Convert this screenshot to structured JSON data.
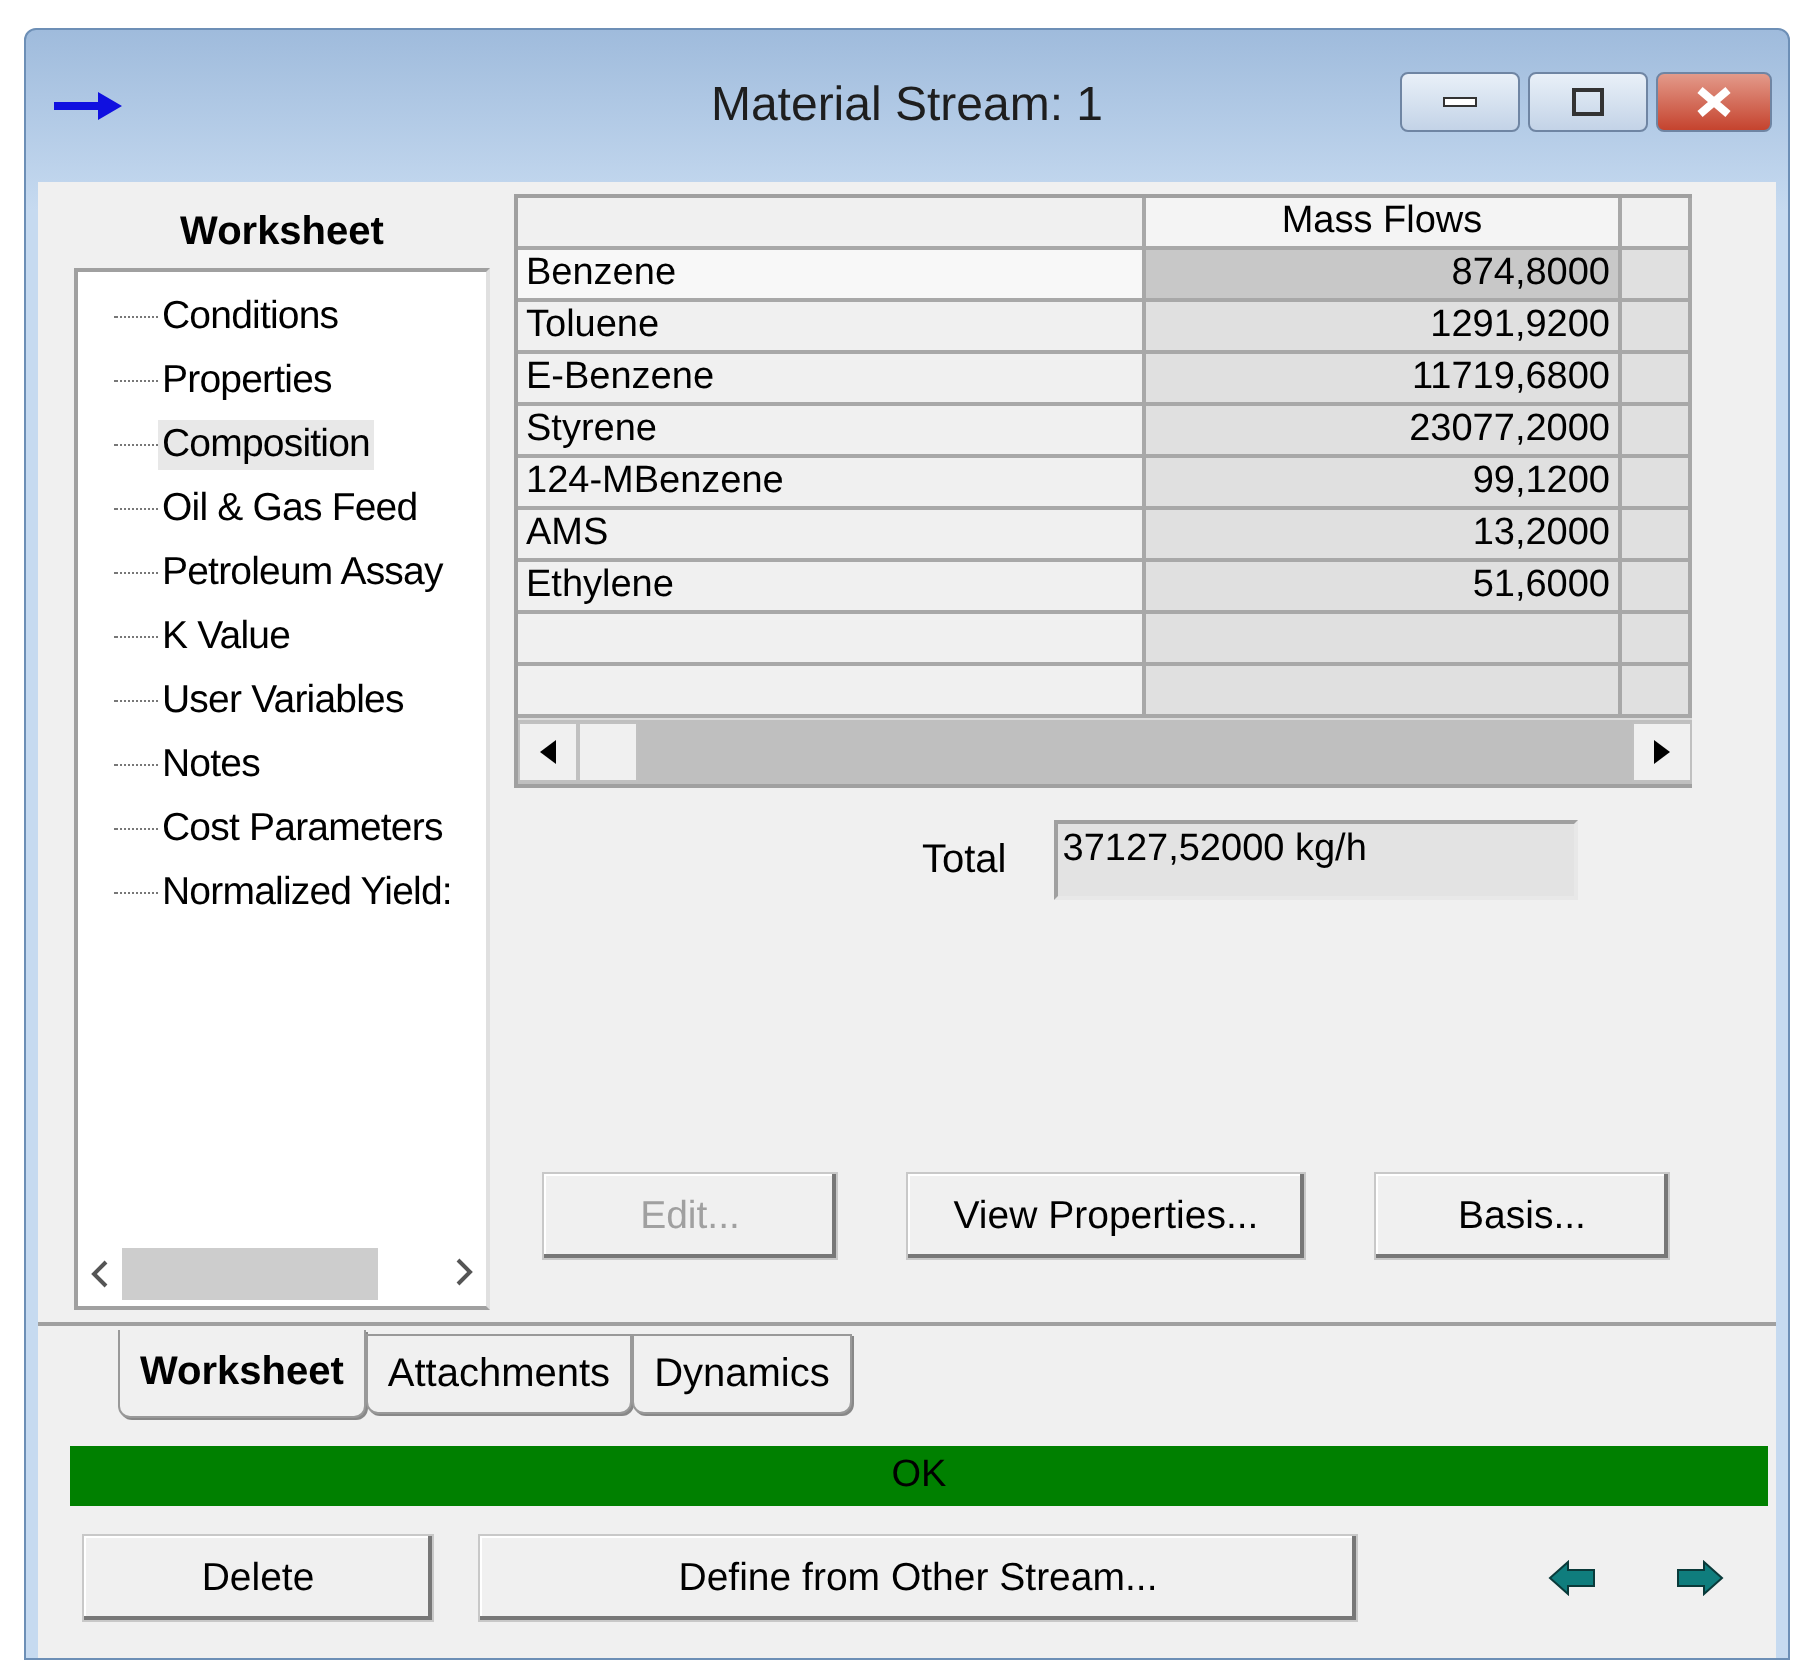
{
  "window": {
    "title": "Material Stream: 1"
  },
  "sidebar": {
    "title": "Worksheet",
    "items": [
      {
        "label": "Conditions",
        "selected": false
      },
      {
        "label": "Properties",
        "selected": false
      },
      {
        "label": "Composition",
        "selected": true
      },
      {
        "label": "Oil & Gas Feed",
        "selected": false
      },
      {
        "label": "Petroleum Assay",
        "selected": false
      },
      {
        "label": "K Value",
        "selected": false
      },
      {
        "label": "User Variables",
        "selected": false
      },
      {
        "label": "Notes",
        "selected": false
      },
      {
        "label": "Cost Parameters",
        "selected": false
      },
      {
        "label": "Normalized Yield:",
        "selected": false
      }
    ]
  },
  "table": {
    "columns": [
      "Mass Flows"
    ],
    "rows": [
      {
        "name": "Benzene",
        "value": "874,8000",
        "selected": true
      },
      {
        "name": "Toluene",
        "value": "1291,9200",
        "selected": false
      },
      {
        "name": "E-Benzene",
        "value": "11719,6800",
        "selected": false
      },
      {
        "name": "Styrene",
        "value": "23077,2000",
        "selected": false
      },
      {
        "name": "124-MBenzene",
        "value": "99,1200",
        "selected": false
      },
      {
        "name": "AMS",
        "value": "13,2000",
        "selected": false
      },
      {
        "name": "Ethylene",
        "value": "51,6000",
        "selected": false
      }
    ]
  },
  "total": {
    "label": "Total",
    "value": "37127,52000 kg/h"
  },
  "buttons": [
    {
      "label": "Edit...",
      "disabled": true
    },
    {
      "label": "View Properties...",
      "disabled": false
    },
    {
      "label": "Basis...",
      "disabled": false
    }
  ],
  "tabs": [
    {
      "label": "Worksheet",
      "selected": true
    },
    {
      "label": "Attachments",
      "selected": false
    },
    {
      "label": "Dynamics",
      "selected": false
    }
  ],
  "status": {
    "text": "OK",
    "color": "#008000"
  },
  "footer_buttons": [
    "Delete",
    "Define from Other Stream..."
  ]
}
